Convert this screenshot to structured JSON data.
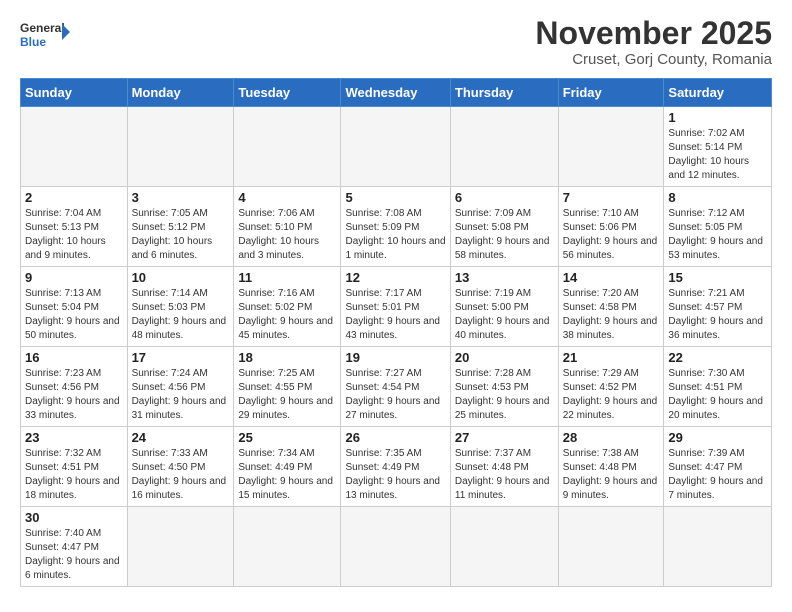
{
  "logo": {
    "general": "General",
    "blue": "Blue"
  },
  "header": {
    "month": "November 2025",
    "location": "Cruset, Gorj County, Romania"
  },
  "weekdays": [
    "Sunday",
    "Monday",
    "Tuesday",
    "Wednesday",
    "Thursday",
    "Friday",
    "Saturday"
  ],
  "days": [
    {
      "date": "",
      "info": ""
    },
    {
      "date": "",
      "info": ""
    },
    {
      "date": "",
      "info": ""
    },
    {
      "date": "",
      "info": ""
    },
    {
      "date": "",
      "info": ""
    },
    {
      "date": "",
      "info": ""
    },
    {
      "date": "1",
      "info": "Sunrise: 7:02 AM\nSunset: 5:14 PM\nDaylight: 10 hours and 12 minutes."
    },
    {
      "date": "2",
      "info": "Sunrise: 7:04 AM\nSunset: 5:13 PM\nDaylight: 10 hours and 9 minutes."
    },
    {
      "date": "3",
      "info": "Sunrise: 7:05 AM\nSunset: 5:12 PM\nDaylight: 10 hours and 6 minutes."
    },
    {
      "date": "4",
      "info": "Sunrise: 7:06 AM\nSunset: 5:10 PM\nDaylight: 10 hours and 3 minutes."
    },
    {
      "date": "5",
      "info": "Sunrise: 7:08 AM\nSunset: 5:09 PM\nDaylight: 10 hours and 1 minute."
    },
    {
      "date": "6",
      "info": "Sunrise: 7:09 AM\nSunset: 5:08 PM\nDaylight: 9 hours and 58 minutes."
    },
    {
      "date": "7",
      "info": "Sunrise: 7:10 AM\nSunset: 5:06 PM\nDaylight: 9 hours and 56 minutes."
    },
    {
      "date": "8",
      "info": "Sunrise: 7:12 AM\nSunset: 5:05 PM\nDaylight: 9 hours and 53 minutes."
    },
    {
      "date": "9",
      "info": "Sunrise: 7:13 AM\nSunset: 5:04 PM\nDaylight: 9 hours and 50 minutes."
    },
    {
      "date": "10",
      "info": "Sunrise: 7:14 AM\nSunset: 5:03 PM\nDaylight: 9 hours and 48 minutes."
    },
    {
      "date": "11",
      "info": "Sunrise: 7:16 AM\nSunset: 5:02 PM\nDaylight: 9 hours and 45 minutes."
    },
    {
      "date": "12",
      "info": "Sunrise: 7:17 AM\nSunset: 5:01 PM\nDaylight: 9 hours and 43 minutes."
    },
    {
      "date": "13",
      "info": "Sunrise: 7:19 AM\nSunset: 5:00 PM\nDaylight: 9 hours and 40 minutes."
    },
    {
      "date": "14",
      "info": "Sunrise: 7:20 AM\nSunset: 4:58 PM\nDaylight: 9 hours and 38 minutes."
    },
    {
      "date": "15",
      "info": "Sunrise: 7:21 AM\nSunset: 4:57 PM\nDaylight: 9 hours and 36 minutes."
    },
    {
      "date": "16",
      "info": "Sunrise: 7:23 AM\nSunset: 4:56 PM\nDaylight: 9 hours and 33 minutes."
    },
    {
      "date": "17",
      "info": "Sunrise: 7:24 AM\nSunset: 4:56 PM\nDaylight: 9 hours and 31 minutes."
    },
    {
      "date": "18",
      "info": "Sunrise: 7:25 AM\nSunset: 4:55 PM\nDaylight: 9 hours and 29 minutes."
    },
    {
      "date": "19",
      "info": "Sunrise: 7:27 AM\nSunset: 4:54 PM\nDaylight: 9 hours and 27 minutes."
    },
    {
      "date": "20",
      "info": "Sunrise: 7:28 AM\nSunset: 4:53 PM\nDaylight: 9 hours and 25 minutes."
    },
    {
      "date": "21",
      "info": "Sunrise: 7:29 AM\nSunset: 4:52 PM\nDaylight: 9 hours and 22 minutes."
    },
    {
      "date": "22",
      "info": "Sunrise: 7:30 AM\nSunset: 4:51 PM\nDaylight: 9 hours and 20 minutes."
    },
    {
      "date": "23",
      "info": "Sunrise: 7:32 AM\nSunset: 4:51 PM\nDaylight: 9 hours and 18 minutes."
    },
    {
      "date": "24",
      "info": "Sunrise: 7:33 AM\nSunset: 4:50 PM\nDaylight: 9 hours and 16 minutes."
    },
    {
      "date": "25",
      "info": "Sunrise: 7:34 AM\nSunset: 4:49 PM\nDaylight: 9 hours and 15 minutes."
    },
    {
      "date": "26",
      "info": "Sunrise: 7:35 AM\nSunset: 4:49 PM\nDaylight: 9 hours and 13 minutes."
    },
    {
      "date": "27",
      "info": "Sunrise: 7:37 AM\nSunset: 4:48 PM\nDaylight: 9 hours and 11 minutes."
    },
    {
      "date": "28",
      "info": "Sunrise: 7:38 AM\nSunset: 4:48 PM\nDaylight: 9 hours and 9 minutes."
    },
    {
      "date": "29",
      "info": "Sunrise: 7:39 AM\nSunset: 4:47 PM\nDaylight: 9 hours and 7 minutes."
    },
    {
      "date": "30",
      "info": "Sunrise: 7:40 AM\nSunset: 4:47 PM\nDaylight: 9 hours and 6 minutes."
    },
    {
      "date": "",
      "info": ""
    },
    {
      "date": "",
      "info": ""
    },
    {
      "date": "",
      "info": ""
    },
    {
      "date": "",
      "info": ""
    },
    {
      "date": "",
      "info": ""
    },
    {
      "date": "",
      "info": ""
    }
  ]
}
